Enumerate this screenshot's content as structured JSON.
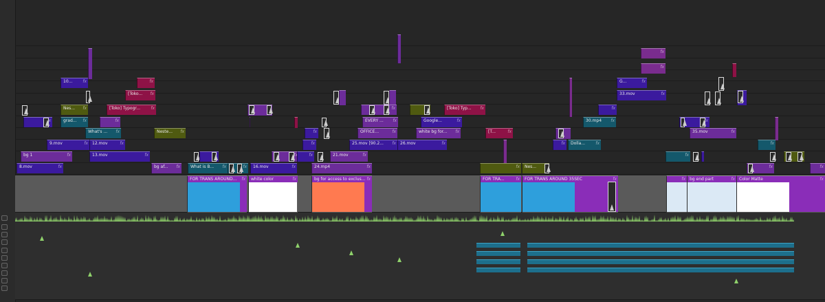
{
  "clip_labels": {
    "c_10": "10...",
    "c_toko1": "[Toko...",
    "c_nes1": "Nes...",
    "c_toko_typogr": "[Toko] Typogr...",
    "c_grad": "grad...",
    "c_whats": "What's ...",
    "c_neste": "Neste...",
    "c_9mov": "9.mov",
    "c_12mov": "12.mov",
    "c_bg1": "bg 1",
    "c_13mov": "13.mov",
    "c_8mov": "8.mov",
    "c_bgaf": "bg af...",
    "c_whatsb": "What is B...",
    "c_16mov": "16.mov",
    "c_24mp4": "24.mp4",
    "c_21mov": "21.mov",
    "c_25mov": "25.mov [90.2...",
    "c_26mov": "26.mov",
    "c_every": "EVERY ...",
    "c_office": "OFFICE...",
    "c_google": "Google...",
    "c_white_bg": "white bg for...",
    "c_toko_typ": "[Toko] Typ...",
    "c_t": "[T...",
    "c_nes2": "Nes...",
    "c_dolla": "Dolla...",
    "c_30mp4": "30.mp4",
    "c_33mov": "33.mov",
    "c_g": "G...",
    "c_35mov": "35.mov",
    "v1_for_trans_around": "FOR TRANS AROUND...",
    "v1_white_color": "white color",
    "v1_bg_access": "bg for access to exclus...",
    "v1_for_tra": "FOR TRA...",
    "v1_for_trans_35": "FOR TRANS AROUND 35SEC",
    "v1_bg_end": "bg end part",
    "v1_color_matte": "Color Matte"
  },
  "fx_label": "fx",
  "colors": {
    "purple": "#6c2c9a",
    "indigo": "#3b1a9e",
    "crimson": "#8e1246",
    "olive": "#4f5a10",
    "teal": "#14586b",
    "magenta": "#7a2c8e",
    "v1_header": "#8a2db8",
    "blue_block": "#2e9fdc",
    "white_block": "#ffffff",
    "orange_block": "#ff7a50",
    "pale_block": "#dbe9f5",
    "waveform": "#8fd16b",
    "v1_bg": "#5a5a5a"
  }
}
